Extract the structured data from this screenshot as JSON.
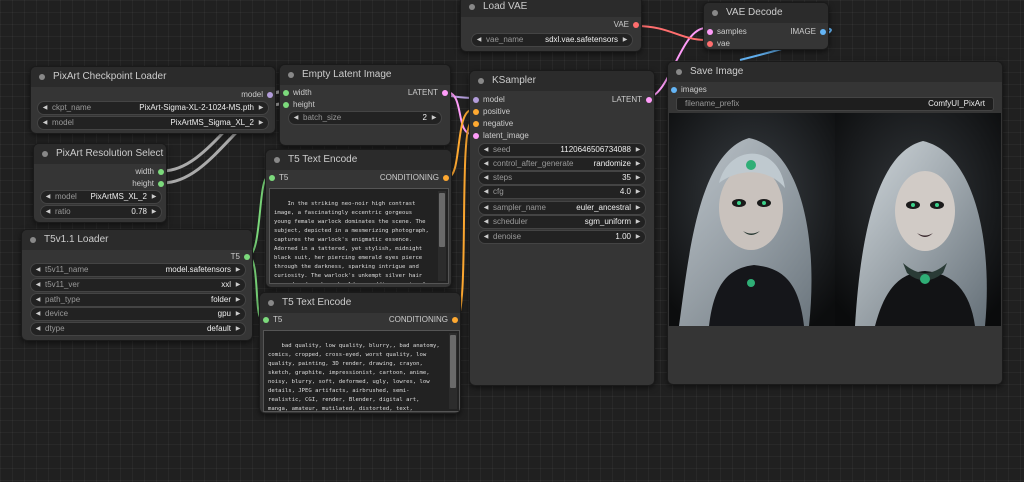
{
  "colors": {
    "canvas_bg": "#202020",
    "node_bg": "#353535",
    "title_bg": "#2b2b2b",
    "pin_model": "#b39ddb",
    "pin_latent": "#ff9cf9",
    "pin_int": "#7cda7c",
    "pin_t5": "#7cda7c",
    "pin_conditioning": "#ffa931",
    "pin_vae": "#ff6e6e",
    "pin_image": "#64b5f6"
  },
  "nodes": {
    "load_vae": {
      "title": "Load VAE",
      "output": "VAE",
      "widget": {
        "label": "vae_name",
        "value": "sdxl.vae.safetensors"
      }
    },
    "vae_decode": {
      "title": "VAE Decode",
      "inputs": [
        "samples",
        "vae"
      ],
      "output": "IMAGE"
    },
    "pixart_checkpoint": {
      "title": "PixArt Checkpoint Loader",
      "output": "model",
      "widgets": [
        {
          "label": "ckpt_name",
          "value": "PixArt-Sigma-XL-2-1024-MS.pth"
        },
        {
          "label": "model",
          "value": "PixArtMS_Sigma_XL_2"
        }
      ]
    },
    "empty_latent": {
      "title": "Empty Latent Image",
      "inputs": [
        "width",
        "height"
      ],
      "output": "LATENT",
      "widget": {
        "label": "batch_size",
        "value": "2"
      }
    },
    "ksampler": {
      "title": "KSampler",
      "inputs": [
        "model",
        "positive",
        "negative",
        "latent_image"
      ],
      "output": "LATENT",
      "widgets": [
        {
          "label": "seed",
          "value": "1120646506734088"
        },
        {
          "label": "control_after_generate",
          "value": "randomize"
        },
        {
          "label": "steps",
          "value": "35"
        },
        {
          "label": "cfg",
          "value": "4.0"
        },
        {
          "label": "sampler_name",
          "value": "euler_ancestral"
        },
        {
          "label": "scheduler",
          "value": "sgm_uniform"
        },
        {
          "label": "denoise",
          "value": "1.00"
        }
      ]
    },
    "save_image": {
      "title": "Save Image",
      "input": "images",
      "widget": {
        "label": "filename_prefix",
        "value": "ComfyUI_PixArt"
      }
    },
    "resolution_select": {
      "title": "PixArt Resolution Select",
      "outputs": [
        "width",
        "height"
      ],
      "widgets": [
        {
          "label": "model",
          "value": "PixArtMS_XL_2"
        },
        {
          "label": "ratio",
          "value": "0.78"
        }
      ]
    },
    "t5_encode_pos": {
      "title": "T5 Text Encode",
      "input": "T5",
      "output": "CONDITIONING",
      "text": "In the striking neo-noir high contrast image, a fascinatingly eccentric gorgeous young female warlock dominates the scene. The subject, depicted in a mesmerizing photograph, captures the warlock's enigmatic essence. Adorned in a tattered, yet stylish, midnight black suit, her piercing emerald eyes pierce through the darkness, sparking intrigue and curiosity. The warlock's unkempt silver hair cascades down her shoulders, adding an air of mystery to her persona. her pale skin bears intricate, intricate and captivating tattoos, emanating an"
    },
    "t5_loader": {
      "title": "T5v1.1 Loader",
      "output": "T5",
      "widgets": [
        {
          "label": "t5v11_name",
          "value": "model.safetensors"
        },
        {
          "label": "t5v11_ver",
          "value": "xxl"
        },
        {
          "label": "path_type",
          "value": "folder"
        },
        {
          "label": "device",
          "value": "gpu"
        },
        {
          "label": "dtype",
          "value": "default"
        }
      ]
    },
    "t5_encode_neg": {
      "title": "T5 Text Encode",
      "input": "T5",
      "output": "CONDITIONING",
      "text": "bad quality, low quality, blurry,, bad anatomy, comics, cropped, cross-eyed, worst quality, low quality, painting, 3D render, drawing, crayon, sketch, graphite, impressionist, cartoon, anime, noisy, blurry, soft, deformed, ugly, lowres, low details, JPEG artifacts, airbrushed, semi-realistic, CGI, render, Blender, digital art, manga, amateur, mutilated, distorted, text, signature, Badbream, (Unrealistic:1.25), bad hands, worse hands, worst hands, disfigured, deformed, disfigured hands,"
    }
  }
}
